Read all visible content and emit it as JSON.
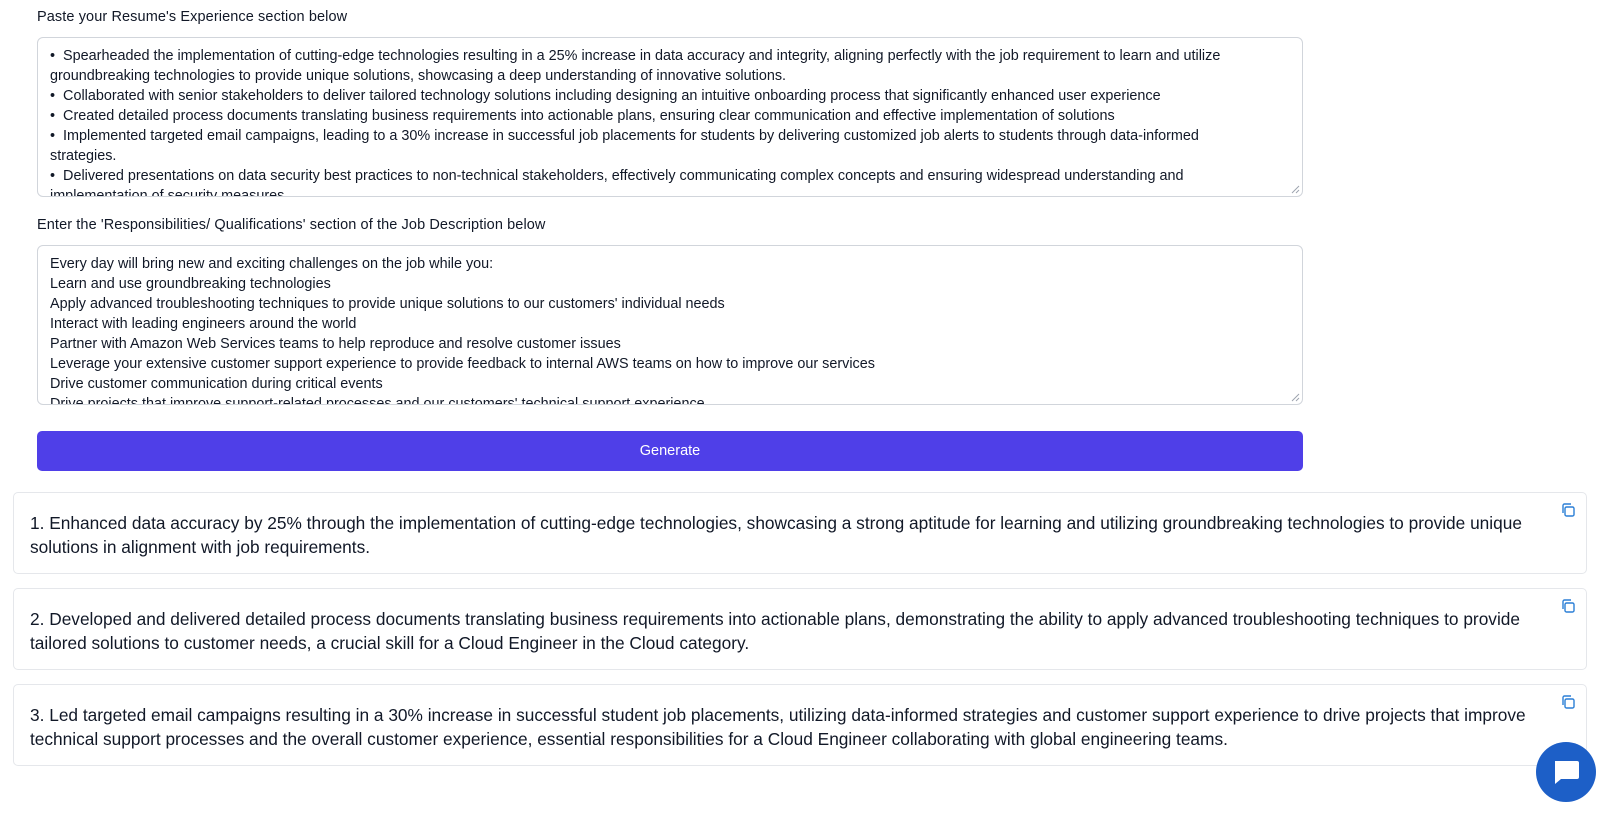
{
  "resume_section": {
    "label": "Paste your Resume's Experience section below",
    "lines": [
      {
        "text": "Spearheaded the implementation of cutting-edge technologies resulting in a 25% increase in data accuracy and integrity, aligning perfectly with the job requirement to learn and utilize",
        "bullet": true
      },
      {
        "text": "groundbreaking technologies to provide unique solutions, showcasing a deep understanding of innovative solutions.",
        "bullet": false
      },
      {
        "text": "Collaborated with senior stakeholders to deliver tailored technology solutions including designing an intuitive onboarding process that significantly enhanced user experience",
        "bullet": true
      },
      {
        "text": "Created detailed process documents translating business requirements into actionable plans, ensuring clear communication and effective implementation of solutions",
        "bullet": true
      },
      {
        "text": "Implemented targeted email campaigns, leading to a 30% increase in successful job placements for students by delivering customized job alerts to students through data-informed",
        "bullet": true
      },
      {
        "text": "strategies.",
        "bullet": false
      },
      {
        "text": "Delivered presentations on data security best practices to non-technical stakeholders, effectively communicating complex concepts and ensuring widespread understanding and",
        "bullet": true
      },
      {
        "text": "implementation of security measures.",
        "bullet": false
      }
    ]
  },
  "job_section": {
    "label": "Enter the 'Responsibilities/ Qualifications' section of the Job Description below",
    "lines": [
      "Every day will bring new and exciting challenges on the job while you:",
      "Learn and use groundbreaking technologies",
      "Apply advanced troubleshooting techniques to provide unique solutions to our customers' individual needs",
      "Interact with leading engineers around the world",
      "Partner with Amazon Web Services teams to help reproduce and resolve customer issues",
      "Leverage your extensive customer support experience to provide feedback to internal AWS teams on how to improve our services",
      "Drive customer communication during critical events",
      "Drive projects that improve support-related processes and our customers' technical support experience"
    ]
  },
  "generate_button": {
    "label": "Generate"
  },
  "results": [
    {
      "text": "1. Enhanced data accuracy by 25% through the implementation of cutting-edge technologies, showcasing a strong aptitude for learning and utilizing groundbreaking technologies to provide unique solutions in alignment with job requirements."
    },
    {
      "text": "2. Developed and delivered detailed process documents translating business requirements into actionable plans, demonstrating the ability to apply advanced troubleshooting techniques to provide tailored solutions to customer needs, a crucial skill for a Cloud Engineer in the Cloud category."
    },
    {
      "text": "3. Led targeted email campaigns resulting in a 30% increase in successful student job placements, utilizing data-informed strategies and customer support experience to drive projects that improve technical support processes and the overall customer experience, essential responsibilities for a Cloud Engineer collaborating with global engineering teams."
    }
  ],
  "icons": {
    "copy": "copy-icon",
    "chat": "chat-bubble-icon",
    "resize": "resize-grip-icon"
  },
  "colors": {
    "primary": "#4f3fe8",
    "chat_button": "#1d5fc7",
    "copy_icon": "#2b7fd6"
  }
}
